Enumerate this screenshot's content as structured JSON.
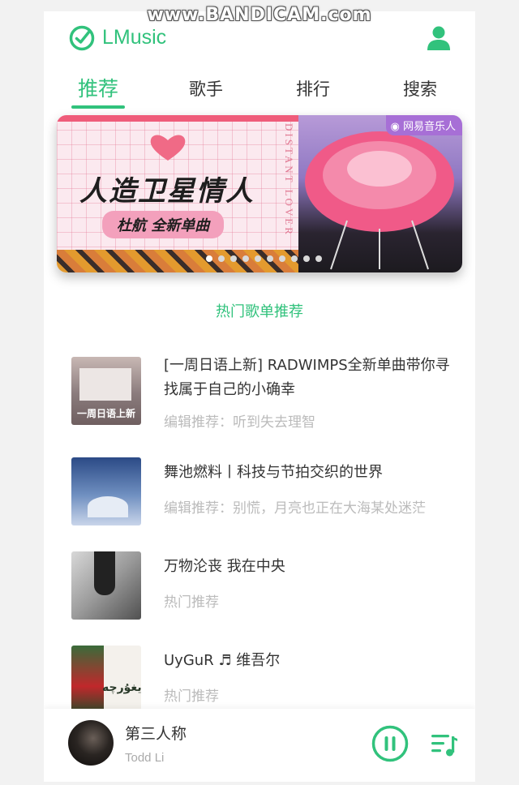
{
  "watermark": "www.BANDICAM.com",
  "header": {
    "brand": "LMusic"
  },
  "tabs": [
    {
      "label": "推荐",
      "active": true
    },
    {
      "label": "歌手",
      "active": false
    },
    {
      "label": "排行",
      "active": false
    },
    {
      "label": "搜索",
      "active": false
    }
  ],
  "banner": {
    "title": "人造卫星情人",
    "subtitle": "杜航 全新单曲",
    "vertical_text": "DISTANT LOVER",
    "tag": "网易音乐人",
    "dot_count": 10,
    "active_dot": 0
  },
  "section_title": "热门歌单推荐",
  "playlists": [
    {
      "title": "[一周日语上新] RADWIMPS全新单曲带你寻找属于自己的小确幸",
      "desc": "编辑推荐：听到失去理智",
      "cover_text": "一周日语上新"
    },
    {
      "title": "舞池燃料丨科技与节拍交织的世界",
      "desc": "编辑推荐：别慌，月亮也正在大海某处迷茫",
      "cover_text": ""
    },
    {
      "title": "万物沦丧 我在中央",
      "desc": "热门推荐",
      "cover_text": ""
    },
    {
      "title": "UyGuR ♬ 维吾尔",
      "desc": "热门推荐",
      "cover_text": "ئۇيغۇرچە"
    }
  ],
  "player": {
    "song": "第三人称",
    "artist": "Todd Li",
    "playing": true
  },
  "colors": {
    "accent": "#31c27c",
    "muted": "#bbbbbb"
  }
}
